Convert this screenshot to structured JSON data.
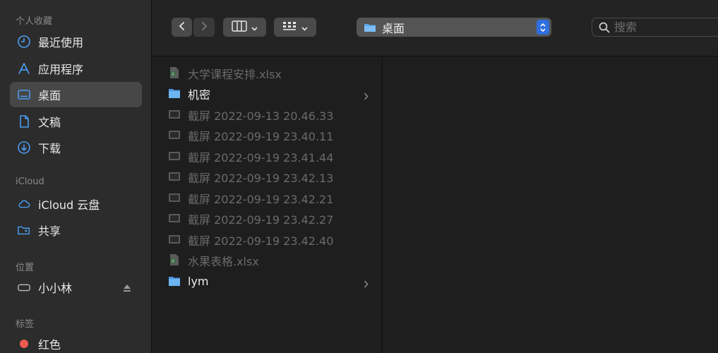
{
  "sidebar": {
    "sections": [
      {
        "label": "个人收藏",
        "items": [
          {
            "label": "最近使用",
            "icon": "clock-icon"
          },
          {
            "label": "应用程序",
            "icon": "apps-icon"
          },
          {
            "label": "桌面",
            "icon": "desktop-icon",
            "selected": true
          },
          {
            "label": "文稿",
            "icon": "document-icon"
          },
          {
            "label": "下载",
            "icon": "download-icon"
          }
        ]
      },
      {
        "label": "iCloud",
        "items": [
          {
            "label": "iCloud 云盘",
            "icon": "cloud-icon"
          },
          {
            "label": "共享",
            "icon": "shared-folder-icon"
          }
        ]
      },
      {
        "label": "位置",
        "items": [
          {
            "label": "小小林",
            "icon": "drive-icon",
            "eject": true
          }
        ]
      },
      {
        "label": "标签",
        "items": [
          {
            "label": "红色",
            "icon": "tag-dot",
            "color": "#ee5a50"
          }
        ]
      }
    ]
  },
  "toolbar": {
    "path": "桌面",
    "search_placeholder": "搜索"
  },
  "files": [
    {
      "name": "大学课程安排.xlsx",
      "type": "xlsx",
      "dim": true
    },
    {
      "name": "机密",
      "type": "folder",
      "dim": false,
      "has_children": true
    },
    {
      "name": "截屏 2022-09-13 20.46.33",
      "type": "screenshot",
      "dim": true
    },
    {
      "name": "截屏 2022-09-19 23.40.11",
      "type": "screenshot",
      "dim": true
    },
    {
      "name": "截屏 2022-09-19 23.41.44",
      "type": "screenshot",
      "dim": true
    },
    {
      "name": "截屏 2022-09-19 23.42.13",
      "type": "screenshot",
      "dim": true
    },
    {
      "name": "截屏 2022-09-19 23.42.21",
      "type": "screenshot",
      "dim": true
    },
    {
      "name": "截屏 2022-09-19 23.42.27",
      "type": "screenshot",
      "dim": true
    },
    {
      "name": "截屏 2022-09-19 23.42.40",
      "type": "screenshot",
      "dim": true
    },
    {
      "name": "水果表格.xlsx",
      "type": "xlsx",
      "dim": true
    },
    {
      "name": "lym",
      "type": "folder",
      "dim": false,
      "has_children": true
    }
  ],
  "colors": {
    "accent": "#2f6fe0",
    "folder": "#5aa7ee",
    "sidebar_icon": "#4a9cf0"
  }
}
